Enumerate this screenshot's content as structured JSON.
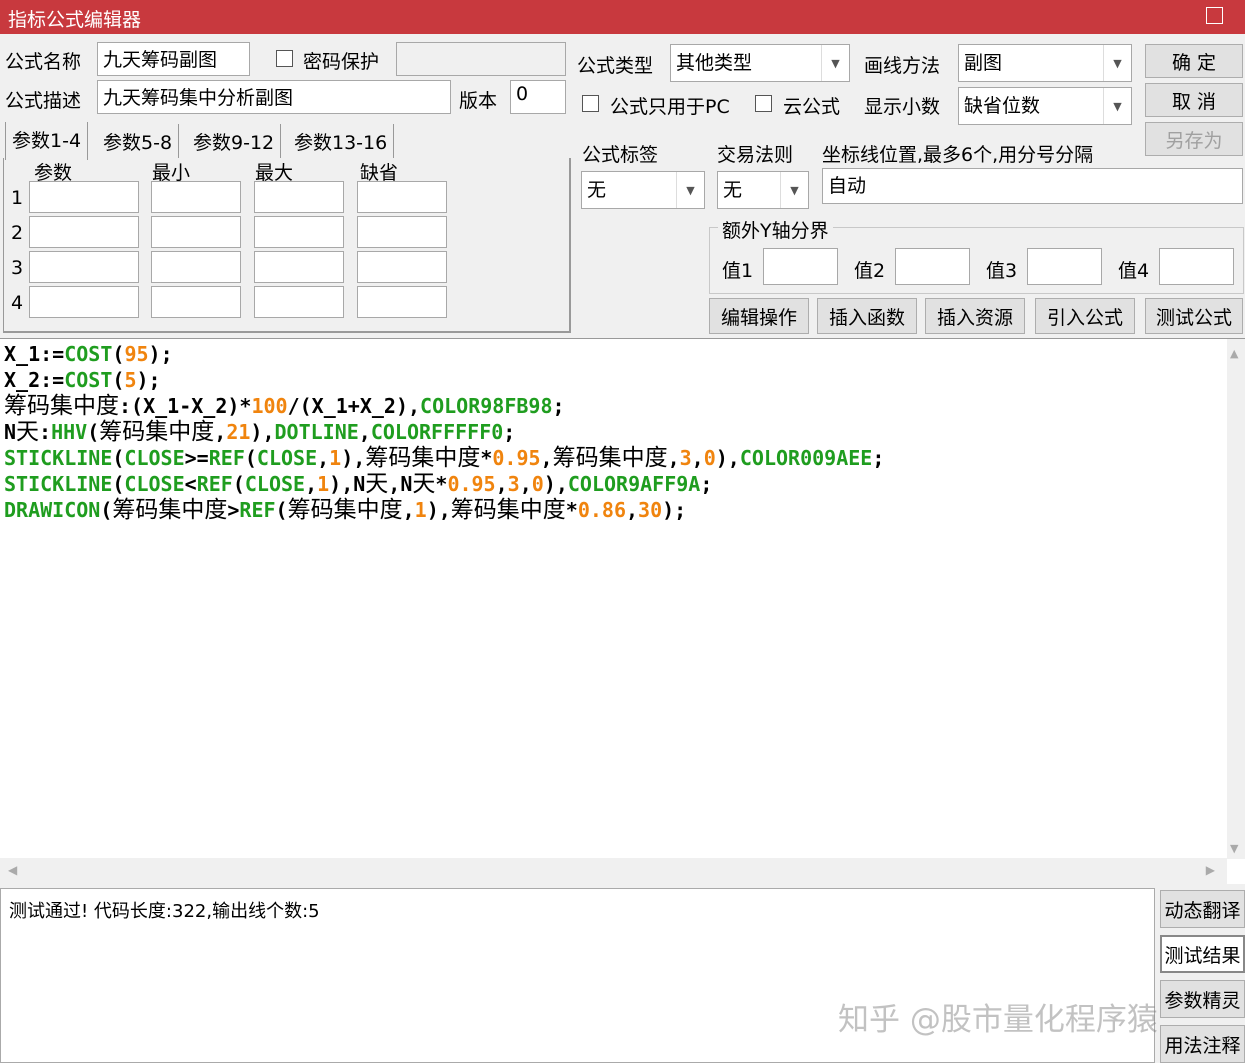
{
  "window": {
    "title": "指标公式编辑器"
  },
  "form": {
    "name_label": "公式名称",
    "name_value": "九天筹码副图",
    "password_label": "密码保护",
    "password_checked": false,
    "password_value": "",
    "desc_label": "公式描述",
    "desc_value": "九天筹码集中分析副图",
    "version_label": "版本",
    "version_value": "0",
    "type_label": "公式类型",
    "type_value": "其他类型",
    "draw_label": "画线方法",
    "draw_value": "副图",
    "pc_only_label": "公式只用于PC",
    "pc_only_checked": false,
    "cloud_label": "云公式",
    "cloud_checked": false,
    "decimal_label": "显示小数",
    "decimal_value": "缺省位数",
    "tag_label": "公式标签",
    "tag_value": "无",
    "rule_label": "交易法则",
    "rule_value": "无",
    "axis_label": "坐标线位置,最多6个,用分号分隔",
    "axis_value": "自动",
    "yaxis_group": "额外Y轴分界",
    "yaxis_values": [
      {
        "label": "值1",
        "value": ""
      },
      {
        "label": "值2",
        "value": ""
      },
      {
        "label": "值3",
        "value": ""
      },
      {
        "label": "值4",
        "value": ""
      }
    ]
  },
  "buttons": {
    "ok": "确 定",
    "cancel": "取 消",
    "save_as": "另存为",
    "actions": [
      "编辑操作",
      "插入函数",
      "插入资源",
      "引入公式",
      "测试公式"
    ],
    "side": [
      "动态翻译",
      "测试结果",
      "参数精灵",
      "用法注释"
    ]
  },
  "params": {
    "tabs": [
      "参数1-4",
      "参数5-8",
      "参数9-12",
      "参数13-16"
    ],
    "active_tab": 0,
    "headers": [
      "参数",
      "最小",
      "最大",
      "缺省"
    ],
    "rows": [
      "1",
      "2",
      "3",
      "4"
    ]
  },
  "code": [
    [
      [
        "t",
        "X_1:="
      ],
      [
        "k",
        "COST"
      ],
      [
        "t",
        "("
      ],
      [
        "n",
        "95"
      ],
      [
        "t",
        ");"
      ]
    ],
    [
      [
        "t",
        "X_2:="
      ],
      [
        "k",
        "COST"
      ],
      [
        "t",
        "("
      ],
      [
        "n",
        "5"
      ],
      [
        "t",
        ");"
      ]
    ],
    [
      [
        "c",
        "筹码集中度"
      ],
      [
        "t",
        ":(X_1-X_2)*"
      ],
      [
        "n",
        "100"
      ],
      [
        "t",
        "/(X_1+X_2),"
      ],
      [
        "k",
        "COLOR98FB98"
      ],
      [
        "t",
        ";"
      ]
    ],
    [
      [
        "t",
        "N"
      ],
      [
        "c",
        "天"
      ],
      [
        "t",
        ":"
      ],
      [
        "k",
        "HHV"
      ],
      [
        "t",
        "("
      ],
      [
        "c",
        "筹码集中度"
      ],
      [
        "t",
        ","
      ],
      [
        "n",
        "21"
      ],
      [
        "t",
        "),"
      ],
      [
        "k",
        "DOTLINE"
      ],
      [
        "t",
        ","
      ],
      [
        "k",
        "COLORFFFFF0"
      ],
      [
        "t",
        ";"
      ]
    ],
    [
      [
        "k",
        "STICKLINE"
      ],
      [
        "t",
        "("
      ],
      [
        "k",
        "CLOSE"
      ],
      [
        "t",
        ">="
      ],
      [
        "k",
        "REF"
      ],
      [
        "t",
        "("
      ],
      [
        "k",
        "CLOSE"
      ],
      [
        "t",
        ","
      ],
      [
        "n",
        "1"
      ],
      [
        "t",
        "),"
      ],
      [
        "c",
        "筹码集中度"
      ],
      [
        "t",
        "*"
      ],
      [
        "n",
        "0.95"
      ],
      [
        "t",
        ","
      ],
      [
        "c",
        "筹码集中度"
      ],
      [
        "t",
        ","
      ],
      [
        "n",
        "3"
      ],
      [
        "t",
        ","
      ],
      [
        "n",
        "0"
      ],
      [
        "t",
        "),"
      ],
      [
        "k",
        "COLOR009AEE"
      ],
      [
        "t",
        ";"
      ]
    ],
    [
      [
        "k",
        "STICKLINE"
      ],
      [
        "t",
        "("
      ],
      [
        "k",
        "CLOSE"
      ],
      [
        "t",
        "<"
      ],
      [
        "k",
        "REF"
      ],
      [
        "t",
        "("
      ],
      [
        "k",
        "CLOSE"
      ],
      [
        "t",
        ","
      ],
      [
        "n",
        "1"
      ],
      [
        "t",
        "),N"
      ],
      [
        "c",
        "天"
      ],
      [
        "t",
        ",N"
      ],
      [
        "c",
        "天"
      ],
      [
        "t",
        "*"
      ],
      [
        "n",
        "0.95"
      ],
      [
        "t",
        ","
      ],
      [
        "n",
        "3"
      ],
      [
        "t",
        ","
      ],
      [
        "n",
        "0"
      ],
      [
        "t",
        "),"
      ],
      [
        "k",
        "COLOR9AFF9A"
      ],
      [
        "t",
        ";"
      ]
    ],
    [
      [
        "k",
        "DRAWICON"
      ],
      [
        "t",
        "("
      ],
      [
        "c",
        "筹码集中度"
      ],
      [
        "t",
        ">"
      ],
      [
        "k",
        "REF"
      ],
      [
        "t",
        "("
      ],
      [
        "c",
        "筹码集中度"
      ],
      [
        "t",
        ","
      ],
      [
        "n",
        "1"
      ],
      [
        "t",
        "),"
      ],
      [
        "c",
        "筹码集中度"
      ],
      [
        "t",
        "*"
      ],
      [
        "n",
        "0.86"
      ],
      [
        "t",
        ","
      ],
      [
        "n",
        "30"
      ],
      [
        "t",
        ");"
      ]
    ]
  ],
  "colors": {
    "keyword": "#1f9d1f",
    "number": "#f0840e",
    "titlebar": "#c8393e"
  },
  "output": {
    "message": "测试通过! 代码长度:322,输出线个数:5"
  },
  "watermark": "知乎 @股市量化程序猿"
}
